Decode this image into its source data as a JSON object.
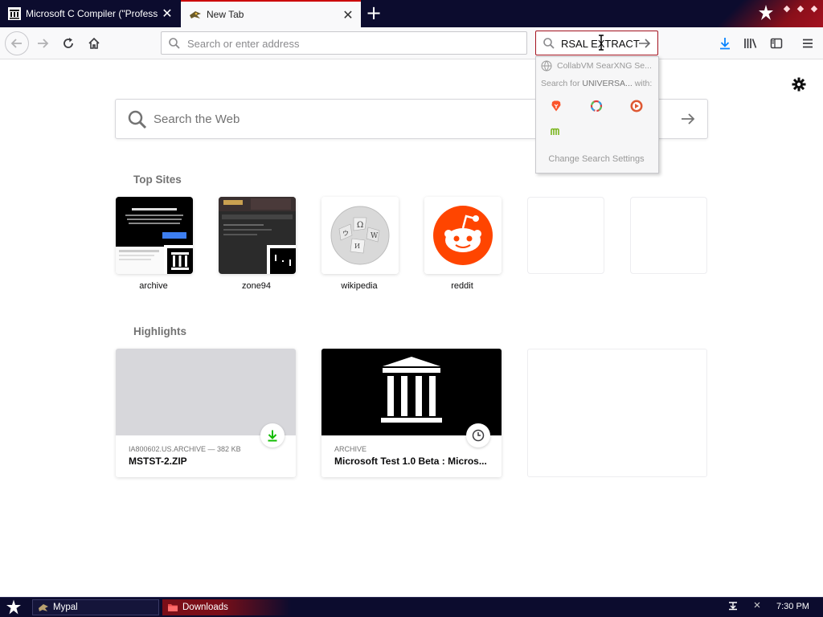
{
  "tabs": [
    {
      "title": "Microsoft C Compiler (\"Professional\"",
      "active": false
    },
    {
      "title": "New Tab",
      "active": true
    }
  ],
  "urlbar": {
    "placeholder": "Search or enter address"
  },
  "searchbar": {
    "value": "RSAL EXTRACT"
  },
  "search_popup": {
    "engine_label": "CollabVM SearXNG Se...",
    "search_for_prefix": "Search for ",
    "search_for_query": "UNIVERSA...",
    "search_for_suffix": " with:",
    "engines": [
      "brave-icon",
      "qwant-icon",
      "duckduckgo-icon",
      "mojeek-icon"
    ],
    "change_settings_label": "Change Search Settings"
  },
  "websearch": {
    "placeholder": "Search the Web"
  },
  "top_sites": {
    "title": "Top Sites",
    "items": [
      {
        "label": "archive"
      },
      {
        "label": "zone94"
      },
      {
        "label": "wikipedia"
      },
      {
        "label": "reddit"
      },
      {
        "label": ""
      },
      {
        "label": ""
      }
    ]
  },
  "highlights": {
    "title": "Highlights",
    "items": [
      {
        "meta": "IA800602.US.ARCHIVE — 382 KB",
        "title": "MSTST-2.ZIP",
        "badge": "download-icon"
      },
      {
        "meta": "ARCHIVE",
        "title": "Microsoft Test 1.0 Beta : Micros...",
        "badge": "clock-icon"
      }
    ]
  },
  "taskbar": {
    "items": [
      {
        "label": "Mypal"
      },
      {
        "label": "Downloads"
      }
    ],
    "clock": "7:30 PM"
  },
  "colors": {
    "tabstrip": "#0c0c2e",
    "accent_red": "#a4121f",
    "reddit": "#ff4500",
    "download_green": "#12bc00"
  }
}
